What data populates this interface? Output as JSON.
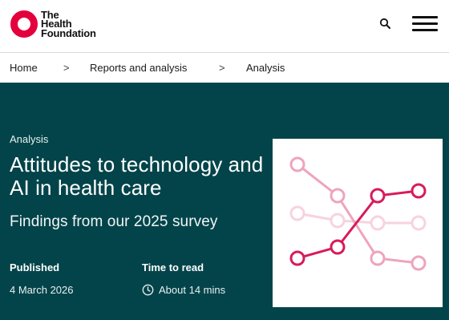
{
  "header": {
    "logo_lines": [
      "The",
      "Health",
      "Foundation"
    ],
    "logo_icon": "ring-logo-icon",
    "search_icon": "search-icon",
    "menu_icon": "hamburger-menu-icon",
    "brand_color": "#e4003b"
  },
  "breadcrumb": {
    "items": [
      "Home",
      "Reports and analysis",
      "Analysis"
    ],
    "separator": ">"
  },
  "hero": {
    "background": "#03444a",
    "eyebrow": "Analysis",
    "title": "Attitudes to technology and AI in health care",
    "subtitle": "Findings from our 2025 survey",
    "published_label": "Published",
    "published_value": "4 March 2026",
    "read_label": "Time to read",
    "read_value": "About 14 mins",
    "read_icon": "clock-icon",
    "illustration_icon": "crossing-lines-illustration"
  }
}
